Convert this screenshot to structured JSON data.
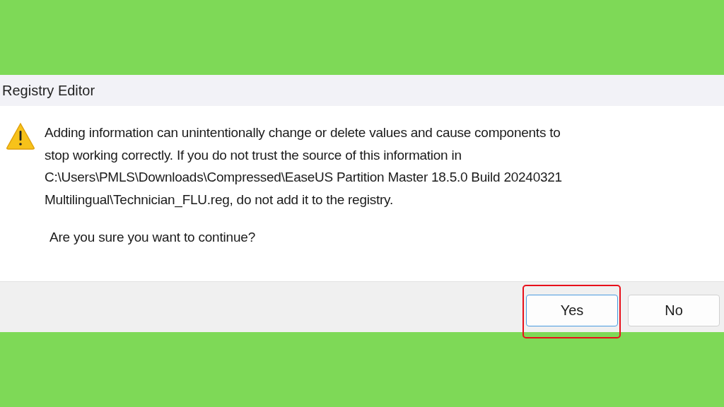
{
  "window": {
    "title": "Registry Editor"
  },
  "message": {
    "text": "Adding information can unintentionally change or delete values and cause components to\nstop working correctly. If you do not trust the source of this information in\nC:\\Users\\PMLS\\Downloads\\Compressed\\EaseUS Partition Master 18.5.0 Build 20240321\nMultilingual\\Technician_FLU.reg, do not add it to the registry."
  },
  "question": "Are you sure you want to continue?",
  "buttons": [
    {
      "label": "Yes",
      "focused": true,
      "highlighted": true
    },
    {
      "label": "No",
      "focused": false,
      "highlighted": false
    }
  ]
}
